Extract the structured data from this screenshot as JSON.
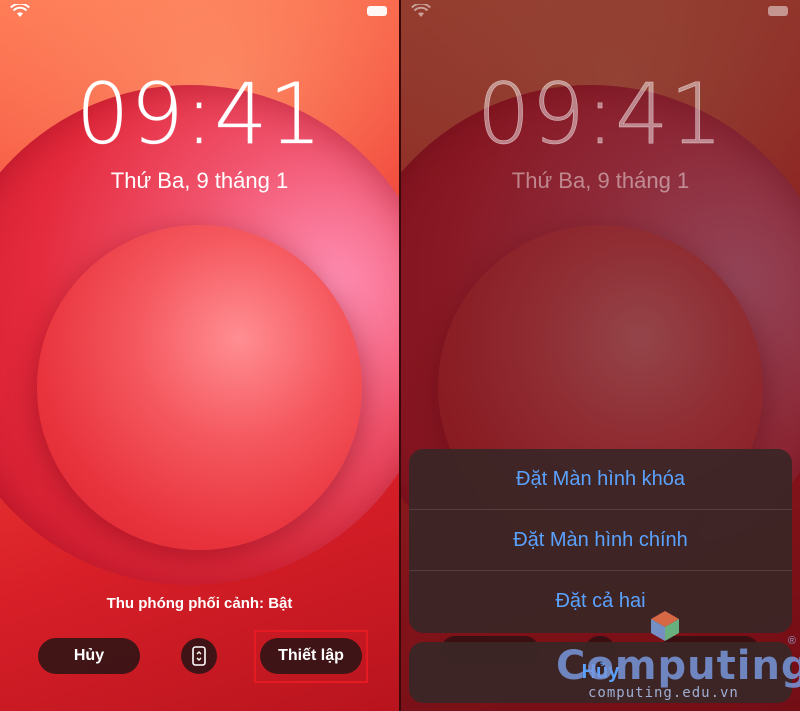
{
  "status_bar": {
    "wifi_icon": "wifi-icon",
    "battery_icon": "battery-icon"
  },
  "left": {
    "time": "09:41",
    "date": "Thứ Ba, 9 tháng 1",
    "zoom_label": "Thu phóng phối cảnh: Bật",
    "cancel_label": "Hủy",
    "perspective_icon": "perspective-zoom-icon",
    "set_label": "Thiết lập"
  },
  "right": {
    "time": "09:41",
    "date": "Thứ Ba, 9 tháng 1",
    "action_sheet": {
      "items": [
        "Đặt Màn hình khóa",
        "Đặt Màn hình chính",
        "Đặt cả hai"
      ],
      "cancel_label": "Hủy"
    }
  },
  "watermark": {
    "brand": "Computing",
    "domain": "computing.edu.vn"
  },
  "colors": {
    "accent_blue": "#5aa2ff",
    "highlight_red": "#e51b24"
  }
}
